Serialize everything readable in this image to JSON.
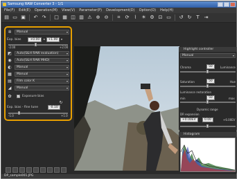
{
  "window": {
    "title": "Samsung RAW Converter 3 - 1/1"
  },
  "menu": [
    "File(F)",
    "Edit(E)",
    "Operation(M)",
    "View(V)",
    "Parameter(P)",
    "Development(D)",
    "Option(O)",
    "Help(H)"
  ],
  "left_panel": {
    "white_balance": "Manual",
    "exp_bias_label": "Exp. bias",
    "exp_bias_minus": "+0.00",
    "exp_bias_plus": "+1.00",
    "range_min": "-2.00",
    "range_max": "+2.00",
    "color_space": "Auto(S&H RAW evaluation)",
    "picture_style": "Auto(S&H RAW MHD)",
    "sharpness": "Manual",
    "noise": "Manual",
    "film": "Film color K",
    "tone": "Manual",
    "exposure_bias_checkbox": "Exposure bias",
    "exp_bias_tune_label": "Exp. bias - fine tune",
    "tune_value": "-0.10",
    "tune_min": "-1.0",
    "tune_max": "+1.0"
  },
  "right_panel": {
    "highlight_title": "Highlight controller",
    "highlight_select": "Manual",
    "chroma_label": "Chroma",
    "chroma_value": "50",
    "luminance_label": "Luminance",
    "saturation_label": "Saturation",
    "saturation_value": "50",
    "hue_label": "Hue",
    "lum_restoration_label": "Luminance restoration",
    "lum_min": "min",
    "lum_value": "50",
    "lum_max": "max",
    "dynamic_range_label": "Dynamic range",
    "dr_expansion_label": "DR expansion",
    "dr_low": "+0.00EV",
    "dr_mid": "0.00",
    "dr_high": "+6.00EV",
    "histogram_title": "Histogram"
  },
  "status": {
    "filename": "DP_sample001.JPG"
  },
  "colors": {
    "highlight_outline": "#e8a000",
    "panel_bg": "#2c2c2c",
    "title_bar": "#3f6eb5"
  }
}
